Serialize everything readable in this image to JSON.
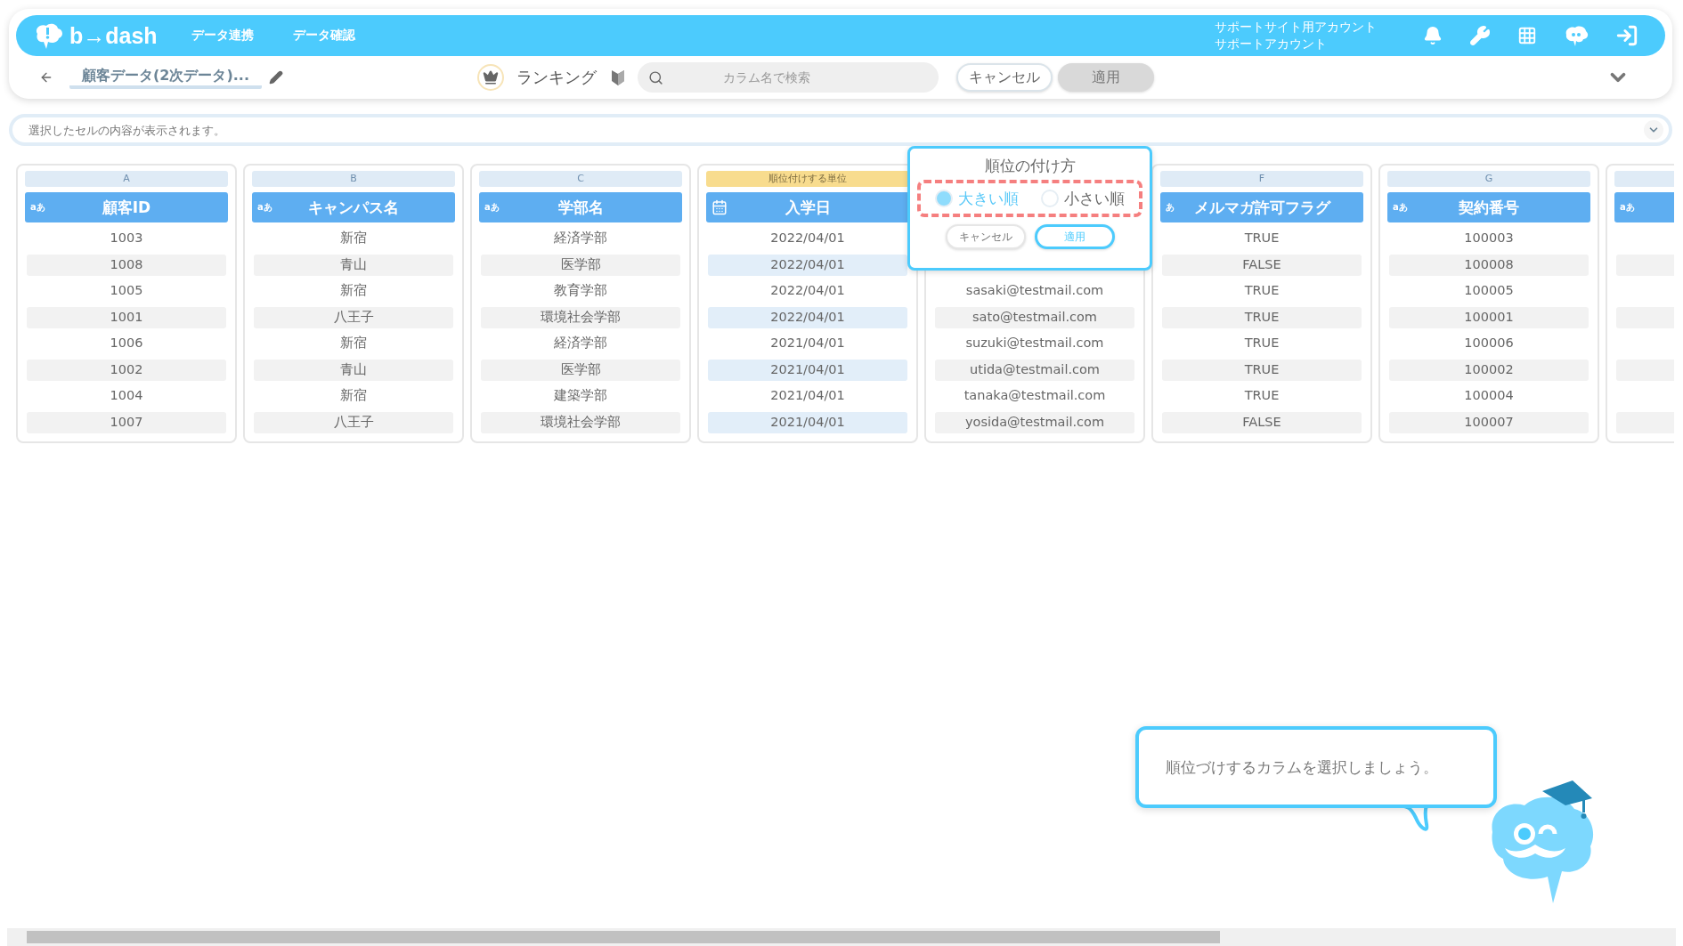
{
  "header": {
    "logo": "b→dash",
    "nav": [
      "データ連携",
      "データ確認"
    ],
    "account": [
      "サポートサイト用アカウント",
      "サポートアカウント"
    ]
  },
  "toolbar": {
    "title": "顧客データ(2次データ)...",
    "mode": "ランキング",
    "search": {
      "placeholder": "カラム名で検索"
    },
    "cancel": "キャンセル",
    "apply": {
      "label": "適用",
      "disabled": true
    }
  },
  "cell_bar": {
    "placeholder": "選択したセルの内容が表示されます。"
  },
  "columns": [
    {
      "kind": "text",
      "type_label": "aあ",
      "letter": "A",
      "name": "顧客ID",
      "selected": false,
      "rows": [
        "1003",
        "1008",
        "1005",
        "1001",
        "1006",
        "1002",
        "1004",
        "1007"
      ]
    },
    {
      "kind": "text",
      "type_label": "aあ",
      "letter": "B",
      "name": "キャンパス名",
      "selected": false,
      "rows": [
        "新宿",
        "青山",
        "新宿",
        "八王子",
        "新宿",
        "青山",
        "新宿",
        "八王子"
      ]
    },
    {
      "kind": "text",
      "type_label": "aあ",
      "letter": "C",
      "name": "学部名",
      "selected": false,
      "rows": [
        "経済学部",
        "医学部",
        "教育学部",
        "環境社会学部",
        "経済学部",
        "医学部",
        "建築学部",
        "環境社会学部"
      ]
    },
    {
      "kind": "date",
      "unit_label": "順位付けする単位",
      "name": "入学日",
      "selected": true,
      "rows": [
        "2022/04/01",
        "2022/04/01",
        "2022/04/01",
        "2022/04/01",
        "2021/04/01",
        "2021/04/01",
        "2021/04/01",
        "2021/04/01"
      ]
    },
    {
      "kind": "covered",
      "selected": false,
      "rows": [
        null,
        null,
        "sasaki@testmail.com",
        "sato@testmail.com",
        "suzuki@testmail.com",
        "utida@testmail.com",
        "tanaka@testmail.com",
        "yosida@testmail.com"
      ]
    },
    {
      "kind": "text",
      "type_label": "あ",
      "letter": "F",
      "name": "メルマガ許可フラグ",
      "selected": false,
      "rows": [
        "TRUE",
        "FALSE",
        "TRUE",
        "TRUE",
        "TRUE",
        "TRUE",
        "TRUE",
        "FALSE"
      ]
    },
    {
      "kind": "text",
      "type_label": "aあ",
      "letter": "G",
      "name": "契約番号",
      "selected": false,
      "rows": [
        "100003",
        "100008",
        "100005",
        "100001",
        "100006",
        "100002",
        "100004",
        "100007"
      ]
    },
    {
      "kind": "text",
      "type_label": "aあ",
      "selected": false,
      "rows": [
        null,
        null,
        null,
        null,
        null,
        null,
        null,
        null
      ]
    }
  ],
  "popover": {
    "title": "順位の付け方",
    "options": [
      {
        "label": "大きい順",
        "selected": true
      },
      {
        "label": "小さい順",
        "selected": false
      }
    ],
    "cancel": "キャンセル",
    "apply": "適用"
  },
  "hint": {
    "text": "順位づけするカラムを選択しましょう。"
  }
}
